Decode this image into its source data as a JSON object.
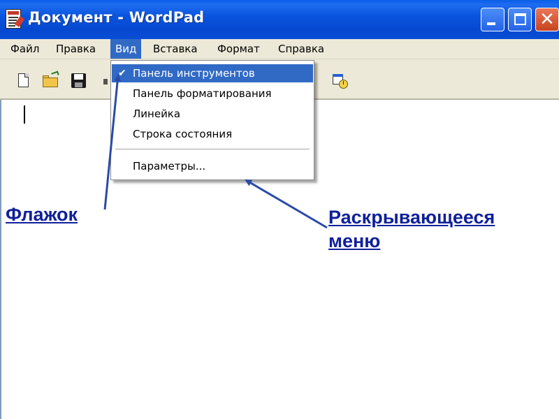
{
  "window": {
    "title": "Документ - WordPad",
    "controls": [
      "minimize",
      "maximize",
      "close"
    ]
  },
  "menubar": {
    "items": [
      "Файл",
      "Правка",
      "Вид",
      "Вставка",
      "Формат",
      "Справка"
    ],
    "active": "Вид"
  },
  "toolbar": {
    "icons": [
      "new-document-icon",
      "open-folder-icon",
      "save-disk-icon",
      "date-time-icon"
    ]
  },
  "view_menu": {
    "items": [
      {
        "label": "Панель инструментов",
        "checked": true,
        "highlighted": true
      },
      {
        "label": "Панель форматирования",
        "checked": false
      },
      {
        "label": "Линейка",
        "checked": false
      },
      {
        "label": "Строка состояния",
        "checked": false
      },
      {
        "label": "Параметры...",
        "checked": false
      }
    ],
    "check_glyph": "✔"
  },
  "annotations": {
    "checkbox_label": "Флажок",
    "dropdown_label": "Раскрывающееся меню"
  },
  "colors": {
    "title_bar": "#0a55df",
    "menu_highlight": "#316ac5",
    "annotation": "#10209a",
    "arrow": "#2b4aa8"
  }
}
